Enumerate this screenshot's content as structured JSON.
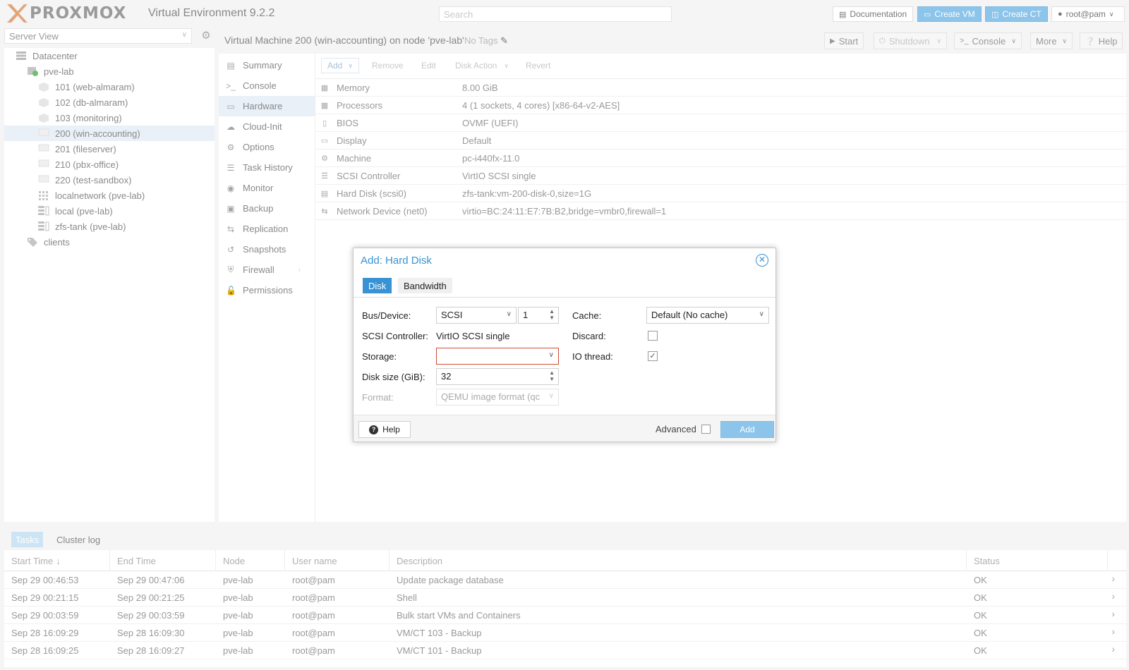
{
  "topbar": {
    "logo": "PROXMOX",
    "version": "Virtual Environment 9.2.2",
    "search_placeholder": "Search",
    "documentation": "Documentation",
    "create_vm": "Create VM",
    "create_ct": "Create CT",
    "user": "root@pam"
  },
  "tree": {
    "view": "Server View",
    "items": [
      {
        "label": "Datacenter",
        "icon": "datacenter-icon"
      },
      {
        "label": "pve-lab",
        "icon": "node-online-icon"
      },
      {
        "label": "101 (web-almaram)",
        "icon": "container-icon"
      },
      {
        "label": "102 (db-almaram)",
        "icon": "container-icon"
      },
      {
        "label": "103 (monitoring)",
        "icon": "container-icon"
      },
      {
        "label": "200 (win-accounting)",
        "icon": "vm-icon"
      },
      {
        "label": "201 (fileserver)",
        "icon": "vm-icon"
      },
      {
        "label": "210 (pbx-office)",
        "icon": "vm-icon"
      },
      {
        "label": "220 (test-sandbox)",
        "icon": "vm-icon"
      },
      {
        "label": "localnetwork (pve-lab)",
        "icon": "network-icon"
      },
      {
        "label": "local (pve-lab)",
        "icon": "storage-icon"
      },
      {
        "label": "zfs-tank (pve-lab)",
        "icon": "storage-icon"
      },
      {
        "label": "clients",
        "icon": "tags-icon"
      }
    ]
  },
  "header": {
    "title": "Virtual Machine 200 (win-accounting) on node 'pve-lab'",
    "tags": "No Tags",
    "start": "Start",
    "shutdown": "Shutdown",
    "console": "Console",
    "more": "More",
    "help": "Help"
  },
  "nav": {
    "items": [
      {
        "label": "Summary"
      },
      {
        "label": "Console"
      },
      {
        "label": "Hardware"
      },
      {
        "label": "Cloud-Init"
      },
      {
        "label": "Options"
      },
      {
        "label": "Task History"
      },
      {
        "label": "Monitor"
      },
      {
        "label": "Backup"
      },
      {
        "label": "Replication"
      },
      {
        "label": "Snapshots"
      },
      {
        "label": "Firewall"
      },
      {
        "label": "Permissions"
      }
    ]
  },
  "hardware": {
    "toolbar": {
      "add": "Add",
      "remove": "Remove",
      "edit": "Edit",
      "disk_action": "Disk Action",
      "revert": "Revert"
    },
    "rows": [
      {
        "name": "Memory",
        "value": "8.00 GiB"
      },
      {
        "name": "Processors",
        "value": "4 (1 sockets, 4 cores) [x86-64-v2-AES]"
      },
      {
        "name": "BIOS",
        "value": "OVMF (UEFI)"
      },
      {
        "name": "Display",
        "value": "Default"
      },
      {
        "name": "Machine",
        "value": "pc-i440fx-11.0"
      },
      {
        "name": "SCSI Controller",
        "value": "VirtIO SCSI single"
      },
      {
        "name": "Hard Disk (scsi0)",
        "value": "zfs-tank:vm-200-disk-0,size=1G"
      },
      {
        "name": "Network Device (net0)",
        "value": "virtio=BC:24:11:E7:7B:B2,bridge=vmbr0,firewall=1"
      }
    ]
  },
  "dialog": {
    "title": "Add: Hard Disk",
    "tabs": [
      "Disk",
      "Bandwidth"
    ],
    "bus_label": "Bus/Device:",
    "bus_value": "SCSI",
    "device_value": "1",
    "scsi_label": "SCSI Controller:",
    "scsi_value": "VirtIO SCSI single",
    "storage_label": "Storage:",
    "storage_value": "",
    "size_label": "Disk size (GiB):",
    "size_value": "32",
    "format_label": "Format:",
    "format_value": "QEMU image format (qc",
    "cache_label": "Cache:",
    "cache_value": "Default (No cache)",
    "discard_label": "Discard:",
    "discard_checked": false,
    "iothread_label": "IO thread:",
    "iothread_checked": true,
    "help": "Help",
    "advanced": "Advanced",
    "add": "Add"
  },
  "tasks": {
    "tabs": [
      "Tasks",
      "Cluster log"
    ],
    "columns": [
      "Start Time",
      "End Time",
      "Node",
      "User name",
      "Description",
      "Status"
    ],
    "rows": [
      {
        "start": "Sep 29 00:46:53",
        "end": "Sep 29 00:47:06",
        "node": "pve-lab",
        "user": "root@pam",
        "desc": "Update package database",
        "status": "OK"
      },
      {
        "start": "Sep 29 00:21:15",
        "end": "Sep 29 00:21:25",
        "node": "pve-lab",
        "user": "root@pam",
        "desc": "Shell",
        "status": "OK"
      },
      {
        "start": "Sep 29 00:03:59",
        "end": "Sep 29 00:03:59",
        "node": "pve-lab",
        "user": "root@pam",
        "desc": "Bulk start VMs and Containers",
        "status": "OK"
      },
      {
        "start": "Sep 28 16:09:29",
        "end": "Sep 28 16:09:30",
        "node": "pve-lab",
        "user": "root@pam",
        "desc": "VM/CT 103 - Backup",
        "status": "OK"
      },
      {
        "start": "Sep 28 16:09:25",
        "end": "Sep 28 16:09:27",
        "node": "pve-lab",
        "user": "root@pam",
        "desc": "VM/CT 101 - Backup",
        "status": "OK"
      }
    ]
  }
}
